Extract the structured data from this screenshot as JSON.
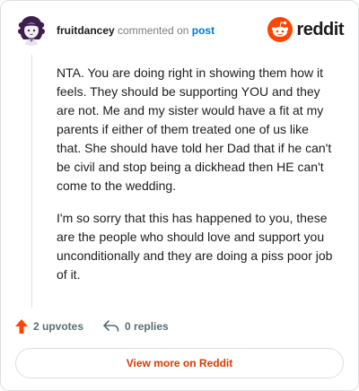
{
  "header": {
    "username": "fruitdancey",
    "verb": "commented on",
    "post_link": "post",
    "brand_name": "reddit"
  },
  "comment": {
    "paragraphs": [
      "NTA. You are doing right in showing them how it feels. They should be supporting YOU and they are not. Me and my sister would have a fit at my parents if either of them treated one of us like that. She should have told her Dad that if he can't be civil and stop being a dickhead then HE can't come to the wedding.",
      "I'm so sorry that this has happened to you, these are the people who should love and support you unconditionally and they are doing a piss poor job of it."
    ]
  },
  "actions": {
    "upvotes": "2 upvotes",
    "replies": "0 replies"
  },
  "footer": {
    "view_more": "View more on Reddit"
  },
  "colors": {
    "brand_orange": "#ff4500",
    "upvote_orange": "#ff4500",
    "link_blue": "#0079d3",
    "cta_red": "#d93a00"
  },
  "icons": {
    "avatar": "avatar-icon",
    "brand": "reddit-logo-icon",
    "upvote": "upvote-arrow-icon",
    "reply": "reply-arrow-icon"
  }
}
